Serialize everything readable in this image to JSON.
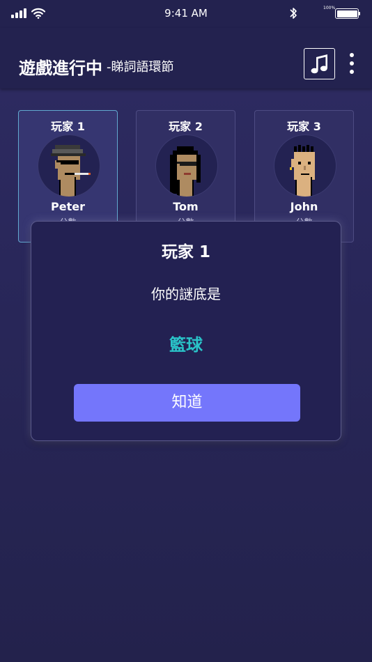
{
  "status_bar": {
    "time": "9:41 AM",
    "battery_percent": "100%",
    "icons": [
      "signal-icon",
      "wifi-icon",
      "bluetooth-icon",
      "battery-icon"
    ]
  },
  "header": {
    "title": "遊戲進行中",
    "subtitle": "-睇詞語環節",
    "music_icon": "music-note-icon",
    "menu_icon": "more-vertical-icon"
  },
  "players": [
    {
      "title": "玩家 1",
      "name": "Peter",
      "score_label": "分數",
      "active": true
    },
    {
      "title": "玩家 2",
      "name": "Tom",
      "score_label": "分數",
      "active": false
    },
    {
      "title": "玩家 3",
      "name": "John",
      "score_label": "分數",
      "active": false
    }
  ],
  "modal": {
    "title": "玩家 1",
    "prompt": "你的謎底是",
    "answer": "籃球",
    "button_label": "知道"
  },
  "colors": {
    "background": "#2b2960",
    "header": "#23224f",
    "accent_button": "#7476fb",
    "answer_text": "#2ac3c8",
    "active_card_border": "#62a9d0"
  }
}
